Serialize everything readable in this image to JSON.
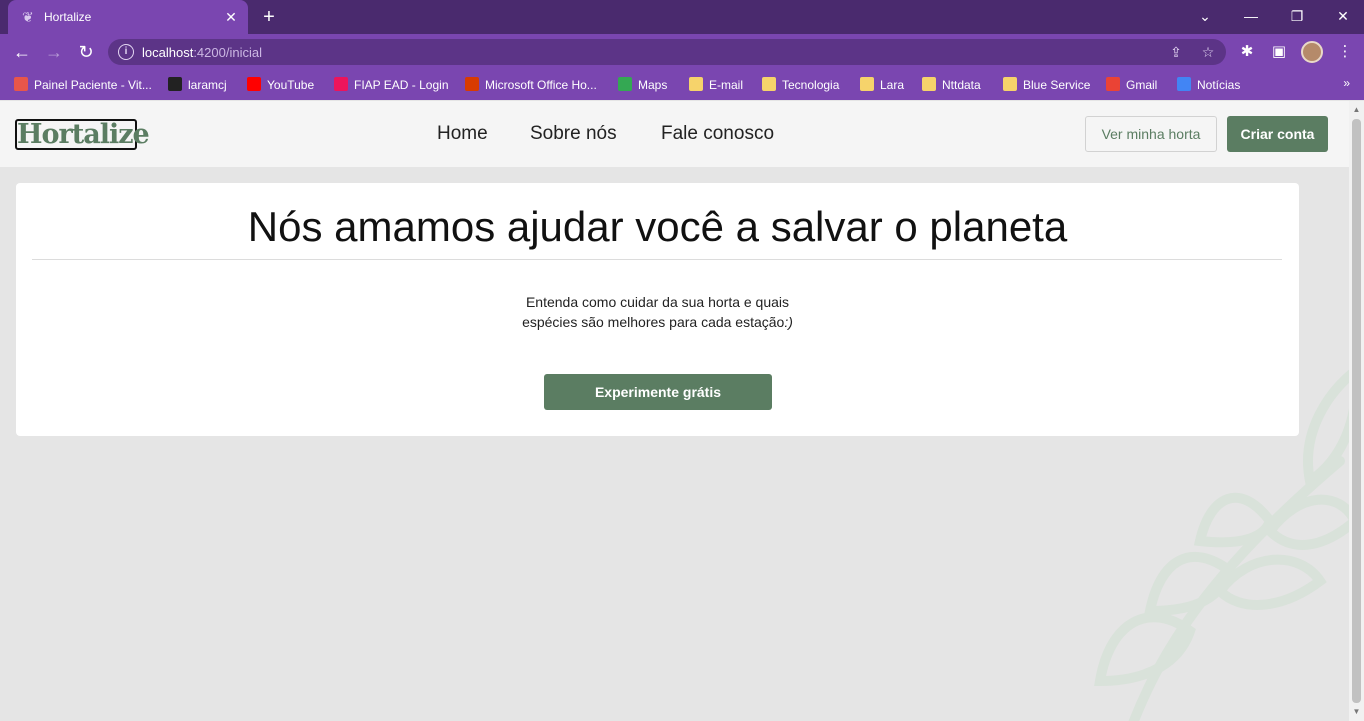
{
  "browser": {
    "tab_title": "Hortalize",
    "tab_close": "✕",
    "new_tab": "+",
    "url_host": "localhost",
    "url_path": ":4200/inicial",
    "bookmarks": [
      {
        "label": "Painel Paciente - Vit...",
        "color": "#e8564a"
      },
      {
        "label": "laramcj",
        "color": "#222222"
      },
      {
        "label": "YouTube",
        "color": "#ff0000"
      },
      {
        "label": "FIAP EAD - Login",
        "color": "#ed145b"
      },
      {
        "label": "Microsoft Office Ho...",
        "color": "#d83b01"
      },
      {
        "label": "Maps",
        "color": "#34a853"
      },
      {
        "label": "E-mail",
        "color": "#f6d36b"
      },
      {
        "label": "Tecnologia",
        "color": "#f6d36b"
      },
      {
        "label": "Lara",
        "color": "#f6d36b"
      },
      {
        "label": "Nttdata",
        "color": "#f6d36b"
      },
      {
        "label": "Blue Service",
        "color": "#f6d36b"
      },
      {
        "label": "Gmail",
        "color": "#ea4335"
      },
      {
        "label": "Notícias",
        "color": "#4285f4"
      }
    ]
  },
  "site": {
    "logo": "Hortalize",
    "nav": {
      "home": "Home",
      "about": "Sobre nós",
      "contact": "Fale conosco"
    },
    "actions": {
      "view_garden": "Ver minha horta",
      "create_account": "Criar conta"
    },
    "hero": {
      "title": "Nós amamos ajudar você a salvar o planeta",
      "text_line1": "Entenda como cuidar da sua horta e quais",
      "text_line2": "espécies são melhores para cada estação",
      "text_smiley": ":)",
      "cta": "Experimente grátis"
    }
  },
  "colors": {
    "brand_green": "#5b7d62",
    "chrome_purple": "#7a46b0",
    "tabbar_purple": "#4a2a6e"
  }
}
